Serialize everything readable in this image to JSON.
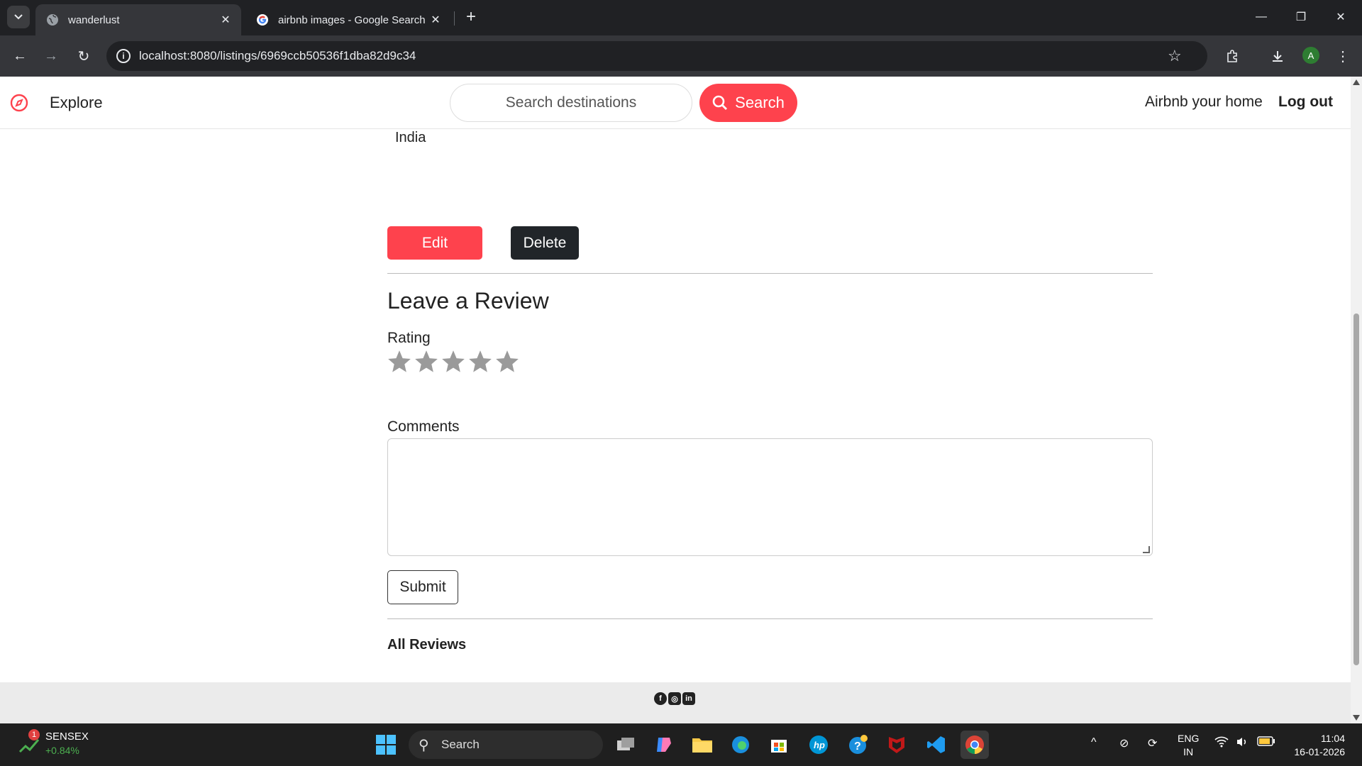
{
  "browser": {
    "tabs": [
      {
        "title": "wanderlust",
        "active": true
      },
      {
        "title": "airbnb images - Google Search",
        "active": false
      }
    ],
    "url": "localhost:8080/listings/6969ccb50536f1dba82d9c34",
    "profile_initial": "A"
  },
  "site": {
    "explore_label": "Explore",
    "search_placeholder": "Search destinations",
    "search_button": "Search",
    "host_link": "Airbnb your home",
    "logout_link": "Log out"
  },
  "listing": {
    "country": "India",
    "edit_label": "Edit",
    "delete_label": "Delete"
  },
  "review_form": {
    "heading": "Leave a Review",
    "rating_label": "Rating",
    "star_count": 5,
    "comments_label": "Comments",
    "comments_value": "",
    "submit_label": "Submit"
  },
  "reviews": {
    "heading": "All Reviews"
  },
  "footer": {
    "socials": [
      "facebook-icon",
      "instagram-icon",
      "linkedin-icon"
    ]
  },
  "taskbar": {
    "widget_badge": "1",
    "widget_name": "SENSEX",
    "widget_value": "+0.84%",
    "search_label": "Search",
    "lang_line1": "ENG",
    "lang_line2": "IN",
    "time": "11:04",
    "date": "16-01-2026"
  },
  "colors": {
    "brand": "#fe424d",
    "dark_button": "#212529"
  }
}
